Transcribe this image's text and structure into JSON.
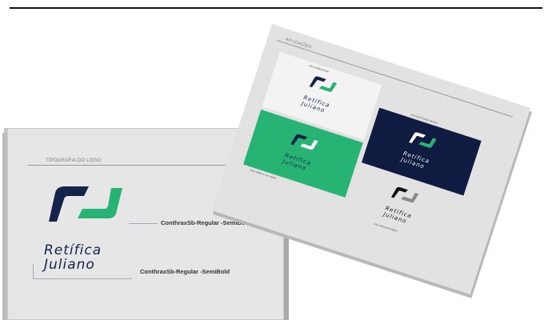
{
  "typography_sheet": {
    "title": "TIPOGRAFIA DO LOGO",
    "logo": {
      "line1": "Retífica",
      "line2": "Juliano"
    },
    "caption_top": "ConthraxSb-Regular -SemiBold",
    "caption_bottom": "ConthraxSb-Regular -SemiBold"
  },
  "applications_sheet": {
    "title": "APLICAÇÕES",
    "panels": [
      {
        "caption": "Uso preferencial",
        "logo_line1": "Retífica",
        "logo_line2": "Juliano"
      },
      {
        "caption": "Uso com fundo escuro",
        "logo_line1": "Retífica",
        "logo_line2": "Juliano"
      },
      {
        "caption": "Uso sobre a cor verde",
        "logo_line1": "Retífica",
        "logo_line2": "Juliano"
      },
      {
        "caption": "Uso monocromático",
        "logo_line1": "Retífica",
        "logo_line2": "Juliano"
      }
    ]
  },
  "colors": {
    "navy": "#14234a",
    "green": "#27b373",
    "dark_panel": "#0f1b40",
    "light_panel": "#f3f3f3",
    "grey_mark": "#8a8a8a"
  }
}
